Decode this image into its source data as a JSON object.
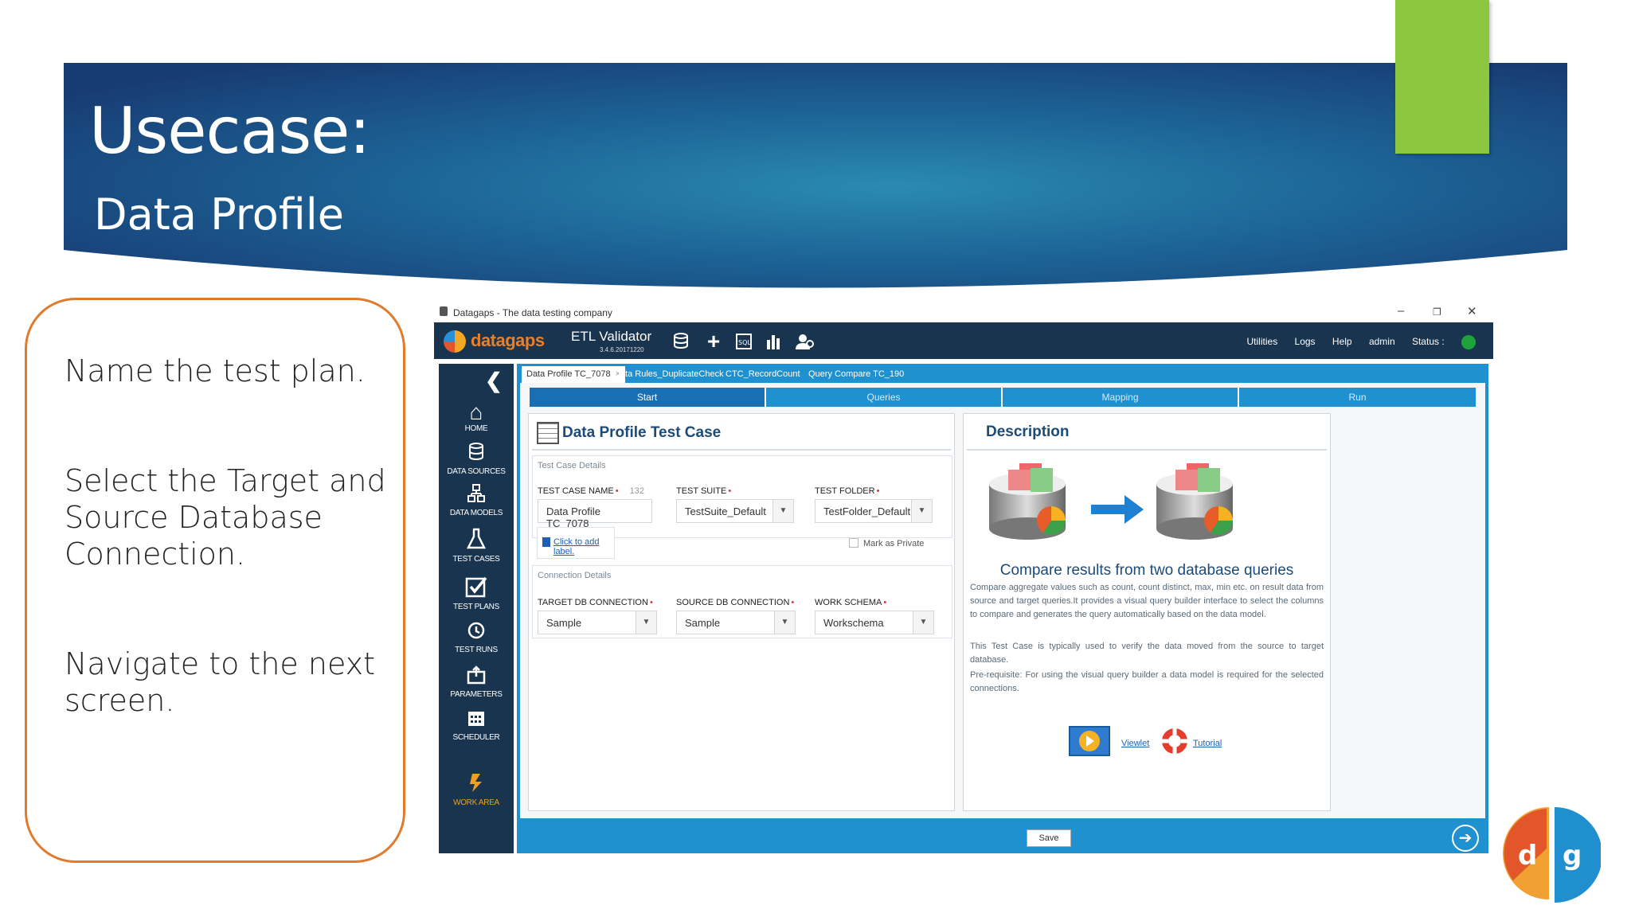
{
  "slide": {
    "title": "Usecase:",
    "subtitle": "Data Profile",
    "steps_text": [
      "Name the test plan.",
      "Select the Target and Source Database Connection.",
      "Navigate to the next screen."
    ]
  },
  "window": {
    "title": "Datagaps - The data testing company",
    "controls": [
      "–",
      "❐",
      "✕"
    ]
  },
  "app": {
    "logo": "datagaps",
    "product": "ETL Validator",
    "version": "3.4.6.20171220",
    "toolbar_icons": [
      "database-icon",
      "plus-icon",
      "sql-icon",
      "chart-icon",
      "user-icon"
    ],
    "toplinks": [
      "Utilities",
      "Logs",
      "Help",
      "admin",
      "Status :"
    ],
    "status_color": "#1fa23a",
    "sidebar": [
      {
        "label": "HOME",
        "icon": "home-icon"
      },
      {
        "label": "DATA SOURCES",
        "icon": "database-icon"
      },
      {
        "label": "DATA MODELS",
        "icon": "model-icon"
      },
      {
        "label": "TEST CASES",
        "icon": "flask-icon"
      },
      {
        "label": "TEST PLANS",
        "icon": "checkbox-icon"
      },
      {
        "label": "TEST RUNS",
        "icon": "history-icon"
      },
      {
        "label": "PARAMETERS",
        "icon": "parameters-icon"
      },
      {
        "label": "SCHEDULER",
        "icon": "calendar-icon"
      },
      {
        "label": "WORK AREA",
        "icon": "workarea-icon"
      }
    ],
    "tabs": [
      {
        "label": "Data Profile TC_7078",
        "active": true
      },
      {
        "label": "Data Rules_DuplicateCheck"
      },
      {
        "label": "CTC_RecordCount"
      },
      {
        "label": "Query Compare TC_190"
      }
    ],
    "steps": [
      "Start",
      "Queries",
      "Mapping",
      "Run"
    ],
    "test_case": {
      "heading": "Data Profile Test Case",
      "details_label": "Test Case Details",
      "name_label": "TEST CASE NAME",
      "name_count": "132",
      "name_value": "Data Profile TC_7078",
      "suite_label": "TEST SUITE",
      "suite_value": "TestSuite_Default",
      "folder_label": "TEST FOLDER",
      "folder_value": "TestFolder_Default",
      "add_label_link": "Click to add label.",
      "private_label": "Mark as Private",
      "connection_label": "Connection Details",
      "target_label": "TARGET DB CONNECTION",
      "target_value": "Sample",
      "source_label": "SOURCE DB CONNECTION",
      "source_value": "Sample",
      "schema_label": "WORK SCHEMA",
      "schema_value": "Workschema"
    },
    "description": {
      "heading": "Description",
      "subtitle": "Compare results from two database queries",
      "p1": "Compare aggregate values such as count, count distinct, max, min etc. on result data from source and target queries.It provides a visual query builder interface to select the columns to compare and generates the query automatically based on the data model.",
      "p2": "This Test Case is typically used to verify the data moved from the source to target database.",
      "p3": "Pre-requisite: For using the visual query builder a data model is required for the selected connections.",
      "viewlet": "Viewlet",
      "tutorial": "Tutorial"
    },
    "save": "Save"
  },
  "colors": {
    "banner_dark": "#173a72",
    "banner_mid": "#1f6c9c",
    "accent_green": "#8dc63f",
    "callout_border": "#e07b2e",
    "app_navy": "#18344f",
    "app_blue": "#1f90d0"
  }
}
